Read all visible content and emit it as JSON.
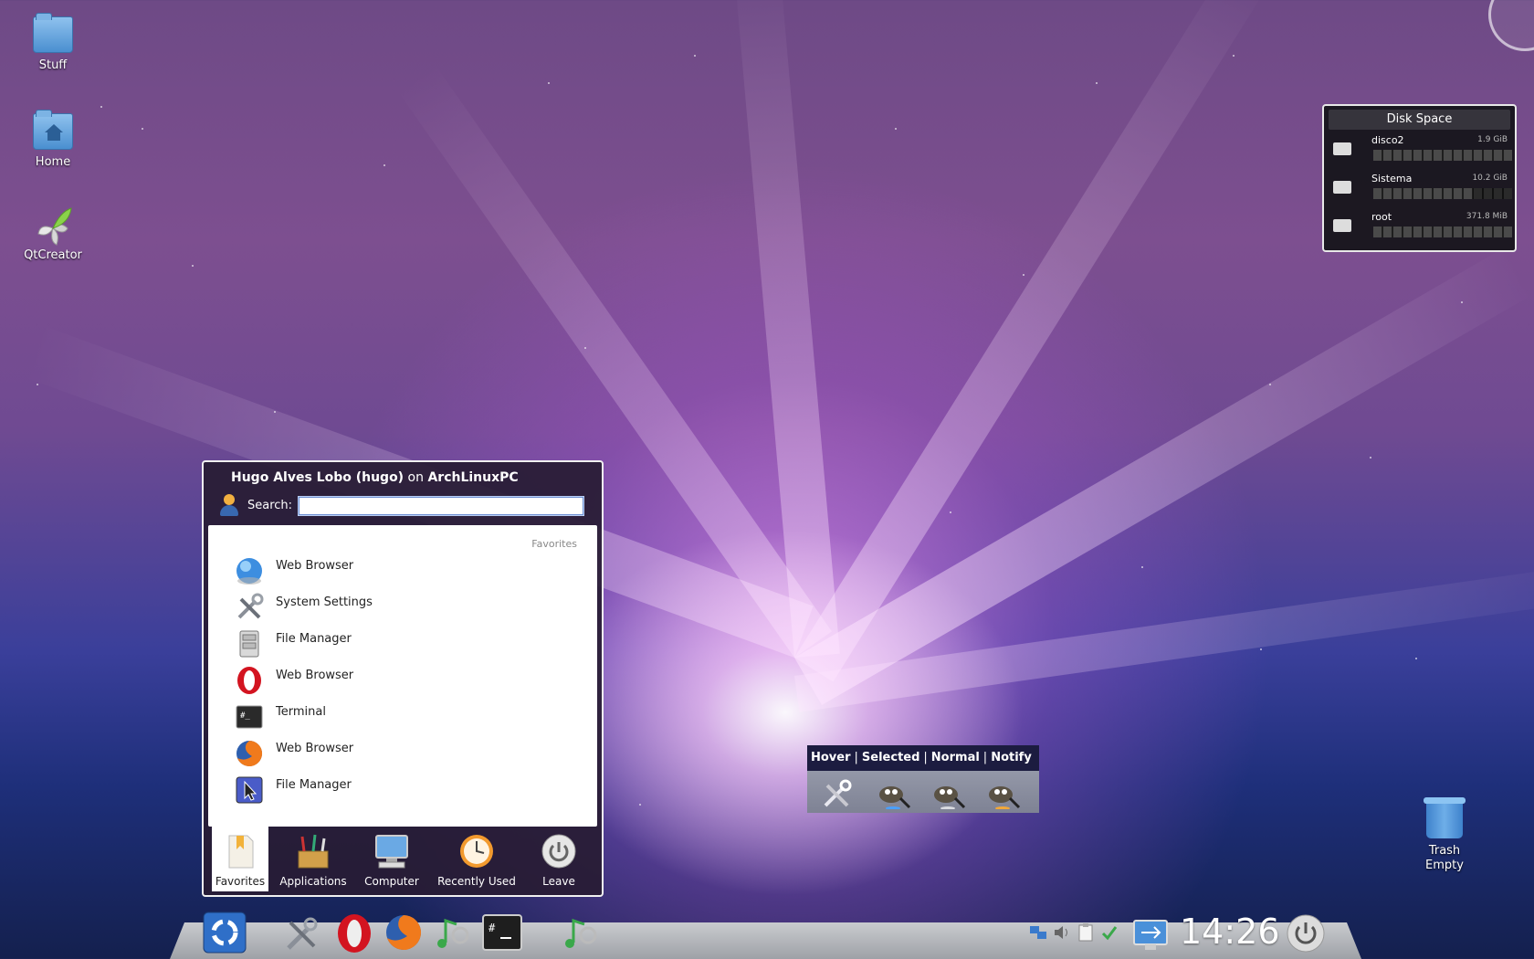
{
  "desktop": {
    "icons": [
      {
        "label": "Stuff",
        "icon": "folder-icon"
      },
      {
        "label": "Home",
        "icon": "home-folder-icon"
      },
      {
        "label": "QtCreator",
        "icon": "qtcreator-icon"
      }
    ],
    "trash": {
      "label_line1": "Trash",
      "label_line2": "Empty",
      "icon": "trash-icon"
    }
  },
  "disk_space": {
    "title": "Disk Space",
    "disks": [
      {
        "name": "disco2",
        "size": "1.9 GiB",
        "usage": 0.97
      },
      {
        "name": "Sistema",
        "size": "10.2 GiB",
        "usage": 0.72
      },
      {
        "name": "root",
        "size": "371.8 MiB",
        "usage": 0.95
      }
    ]
  },
  "kickoff": {
    "user_full": "Hugo Alves Lobo (hugo)",
    "on": "on",
    "host": "ArchLinuxPC",
    "search_label": "Search:",
    "search_value": "",
    "section_title": "Favorites",
    "items": [
      {
        "label": "Web Browser",
        "icon": "konqueror-globe-icon"
      },
      {
        "label": "System Settings",
        "icon": "tools-icon"
      },
      {
        "label": "File Manager",
        "icon": "file-cabinet-icon"
      },
      {
        "label": "Web Browser",
        "icon": "opera-icon"
      },
      {
        "label": "Terminal",
        "icon": "terminal-icon"
      },
      {
        "label": "Web Browser",
        "icon": "firefox-icon"
      },
      {
        "label": "File Manager",
        "icon": "cursor-file-manager-icon"
      }
    ],
    "tabs": [
      {
        "label": "Favorites",
        "icon": "bookmark-icon",
        "active": true
      },
      {
        "label": "Applications",
        "icon": "applications-icon",
        "active": false
      },
      {
        "label": "Computer",
        "icon": "computer-icon",
        "active": false
      },
      {
        "label": "Recently Used",
        "icon": "clock-icon",
        "active": false
      },
      {
        "label": "Leave",
        "icon": "power-icon",
        "active": false
      }
    ]
  },
  "task_states": {
    "hover": "Hover",
    "selected": "Selected",
    "normal": "Normal",
    "notify": "Notify",
    "separator": "|"
  },
  "panel": {
    "launchers": [
      "kickoff-launcher-icon",
      "tools-icon",
      "opera-icon",
      "firefox-icon",
      "music-icon",
      "terminal-icon",
      "music-icon"
    ],
    "tray": [
      "network-icon",
      "volume-icon",
      "clipboard-icon",
      "updates-icon",
      "usb-icon"
    ],
    "clock": "14:26"
  },
  "colors": {
    "panel": "#b5b8bd",
    "menu_bg": "#2c2138",
    "disk_bar": "#4a4a4a"
  }
}
